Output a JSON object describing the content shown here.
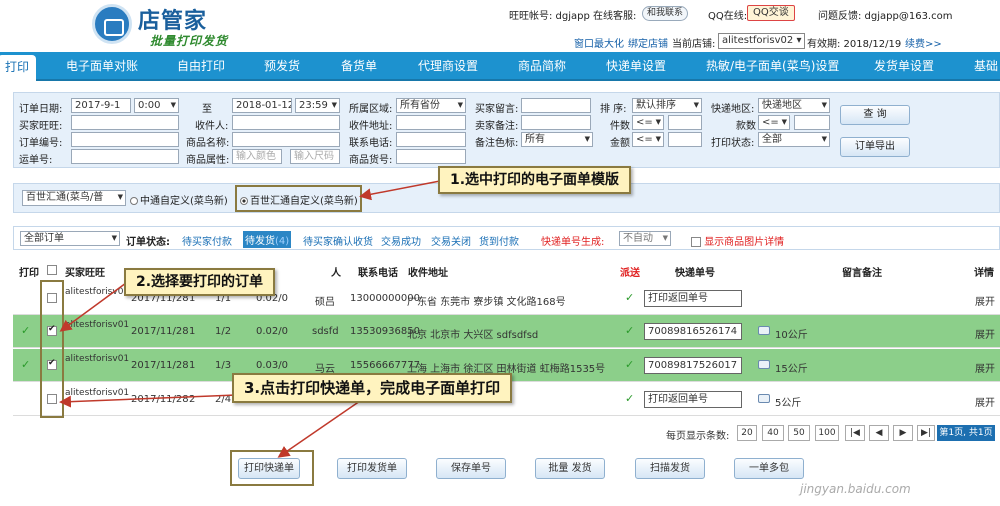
{
  "header": {
    "logo_title": "店管家",
    "logo_sub": "批量打印发货",
    "wangwang_label": "旺旺帐号: dgjapp",
    "online_service_label": "在线客服:",
    "service_btn": "和我联系",
    "qq_label": "QQ在线:",
    "qq_btn": "QQ交谈",
    "feedback": "问题反馈: dgjapp@163.com",
    "window_max": "窗口最大化",
    "bind_store": "绑定店铺",
    "current_store_label": "当前店铺:",
    "current_store": "alitestforisv02",
    "expiry_label": "有效期: 2018/12/19",
    "renew": "续费>>"
  },
  "nav": {
    "tabs": [
      "打印",
      "电子面单对账",
      "自由打印",
      "预发货",
      "备货单",
      "代理商设置",
      "商品简称",
      "快递单设置",
      "热敏/电子面单(菜鸟)设置",
      "发货单设置",
      "基础"
    ]
  },
  "search": {
    "order_date_label": "订单日期:",
    "date_from": "2017-9-1",
    "time_from": "0:00",
    "to_label": "至",
    "date_to": "2018-01-12",
    "time_to": "23:59",
    "region_label": "所属区域:",
    "region": "所有省份",
    "buyer_msg_label": "买家留言:",
    "sort_label": "排  序:",
    "sort": "默认排序",
    "express_region_label": "快递地区:",
    "express_region": "快递地区",
    "query_btn": "查 询",
    "buyer_ww_label": "买家旺旺:",
    "receiver_label": "收件人:",
    "address_label": "收件地址:",
    "seller_note_label": "卖家备注:",
    "count_label": "件数",
    "count_op": "<=",
    "kinds_label": "款数",
    "kinds_op": "<=",
    "order_no_label": "订单编号:",
    "goods_name_label": "商品名称:",
    "phone_label": "联系电话:",
    "note_color_label": "备注色标:",
    "note_color": "所有",
    "amount_label": "金额",
    "amount_op": "<=",
    "print_status_label": "打印状态:",
    "print_status": "全部",
    "export_btn": "订单导出",
    "waybill_label": "运单号:",
    "goods_attr_label": "商品属性:",
    "color_ph": "输入颜色",
    "size_ph": "输入尺码",
    "goods_no_label": "商品货号:"
  },
  "template": {
    "select": "百世汇通(菜鸟/普",
    "option1": "中通自定义(菜鸟新)",
    "option2": "百世汇通自定义(菜鸟新)"
  },
  "filter": {
    "all_orders": "全部订单",
    "status_label": "订单状态:",
    "statuses": [
      "待买家付款",
      "待发货",
      "待买家确认收货",
      "交易成功",
      "交易关闭",
      "货到付款"
    ],
    "pending_count": "(4)",
    "waybill_gen_label": "快递单号生成:",
    "waybill_gen": "不自动",
    "show_img": "显示商品图片详情"
  },
  "table": {
    "headers": [
      "打印",
      "买家旺旺",
      "人",
      "联系电话",
      "收件地址",
      "派送",
      "快递单号",
      "留言备注",
      "详情"
    ],
    "rows": [
      {
        "buyer": "alitestforisv01",
        "date": "2017/11/28",
        "qty": "1",
        "idx": "1/1",
        "amount": "0.02/0",
        "name": "硕吕",
        "phone": "13000000000",
        "address": "广东省 东莞市 寮步镇 文化路168号",
        "tracking": "打印返回单号",
        "weight": "",
        "detail": "展开",
        "checked": false
      },
      {
        "buyer": "alitestforisv01",
        "date": "2017/11/28",
        "qty": "1",
        "idx": "1/2",
        "amount": "0.02/0",
        "name": "sdsfd",
        "phone": "13530936850",
        "address": "北京 北京市 大兴区 sdfsdfsd",
        "tracking": "70089816526174",
        "weight": "10公斤",
        "detail": "展开",
        "checked": true
      },
      {
        "buyer": "alitestforisv01",
        "date": "2017/11/28",
        "qty": "1",
        "idx": "1/3",
        "amount": "0.03/0",
        "name": "马云",
        "phone": "15566667777",
        "address": "上海 上海市 徐汇区 田林街道 虹梅路1535号",
        "tracking": "70089817526017",
        "weight": "15公斤",
        "detail": "展开",
        "checked": true
      },
      {
        "buyer": "alitestforisv01",
        "date": "2017/11/28",
        "qty": "2",
        "idx": "2/4",
        "amount": "",
        "name": "",
        "phone": "",
        "address": "",
        "tracking": "打印返回单号",
        "weight": "5公斤",
        "detail": "展开",
        "checked": false
      }
    ]
  },
  "pager": {
    "label": "每页显示条数:",
    "sizes": [
      "20",
      "40",
      "50",
      "100"
    ],
    "info": "第1页, 共1页"
  },
  "actions": [
    "打印快递单",
    "打印发货单",
    "保存单号",
    "批量 发货",
    "扫描发货",
    "一单多包"
  ],
  "callouts": {
    "step1": "1.选中打印的电子面单模版",
    "step2": "2.选择要打印的订单",
    "step3": "3.点击打印快递单，完成电子面单打印"
  },
  "watermark": "jingyan.baidu.com",
  "colors": {
    "nav": "#1d92cf",
    "selected_row": "#8ccf8a",
    "callout_bg": "#fff3bf",
    "arrow": "#c0392b",
    "red_text": "#e02020"
  }
}
